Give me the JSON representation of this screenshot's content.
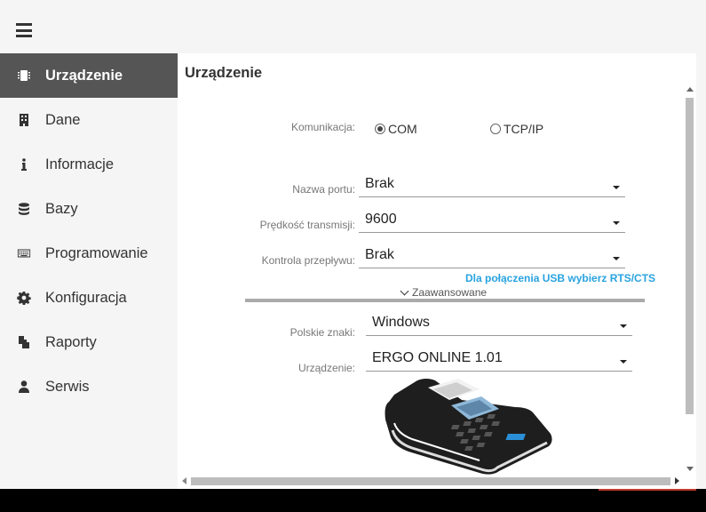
{
  "nav": {
    "items": [
      {
        "label": "Urządzenie",
        "icon": "chip-icon"
      },
      {
        "label": "Dane",
        "icon": "building-icon"
      },
      {
        "label": "Informacje",
        "icon": "info-icon"
      },
      {
        "label": "Bazy",
        "icon": "database-icon"
      },
      {
        "label": "Programowanie",
        "icon": "keyboard-icon"
      },
      {
        "label": "Konfiguracja",
        "icon": "gear-icon"
      },
      {
        "label": "Raporty",
        "icon": "files-icon"
      },
      {
        "label": "Serwis",
        "icon": "user-icon"
      }
    ],
    "active_index": 0
  },
  "panel": {
    "title": "Urządzenie"
  },
  "form": {
    "communication": {
      "label": "Komunikacja:",
      "options": [
        "COM",
        "TCP/IP"
      ],
      "selected": "COM"
    },
    "port_name": {
      "label": "Nazwa portu:",
      "value": "Brak"
    },
    "baud_rate": {
      "label": "Prędkość transmisji:",
      "value": "9600"
    },
    "flow_control": {
      "label": "Kontrola przepływu:",
      "value": "Brak"
    },
    "usb_hint": "Dla połączenia USB wybierz RTS/CTS",
    "advanced_label": "Zaawansowane",
    "polish_chars": {
      "label": "Polskie znaki:",
      "value": "Windows"
    },
    "device": {
      "label": "Urządzenie:",
      "value": "ERGO ONLINE 1.01"
    }
  },
  "colors": {
    "active_nav_bg": "#555555",
    "hint": "#29a3e0",
    "sidebar_bg": "#f5f5f5"
  }
}
